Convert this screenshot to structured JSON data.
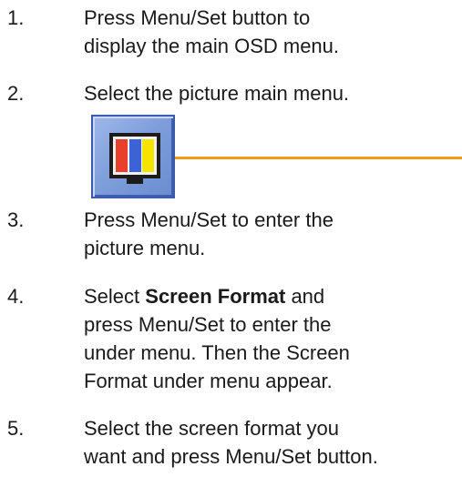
{
  "steps": [
    {
      "number": "1.",
      "lines": [
        "Press Menu/Set button to",
        "display the main OSD menu."
      ]
    },
    {
      "number": "2.",
      "lines": [
        "Select the picture main menu."
      ]
    },
    {
      "number": "3.",
      "lines": [
        "Press Menu/Set to enter the",
        "picture menu."
      ]
    },
    {
      "number": "4.",
      "bold": "Screen Format",
      "lead": "Select ",
      "tail": " and",
      "lines": [
        "press Menu/Set to enter the",
        "under menu. Then the Screen",
        "Format under menu appear."
      ]
    },
    {
      "number": "5.",
      "lines": [
        "Select the screen format you",
        "want and press Menu/Set button."
      ]
    }
  ],
  "figure": {
    "icon": "picture-menu-icon",
    "bar_colors": [
      "#e8402a",
      "#f5e400",
      "#27b24a"
    ],
    "accent_line_color": "#f39a1c"
  }
}
